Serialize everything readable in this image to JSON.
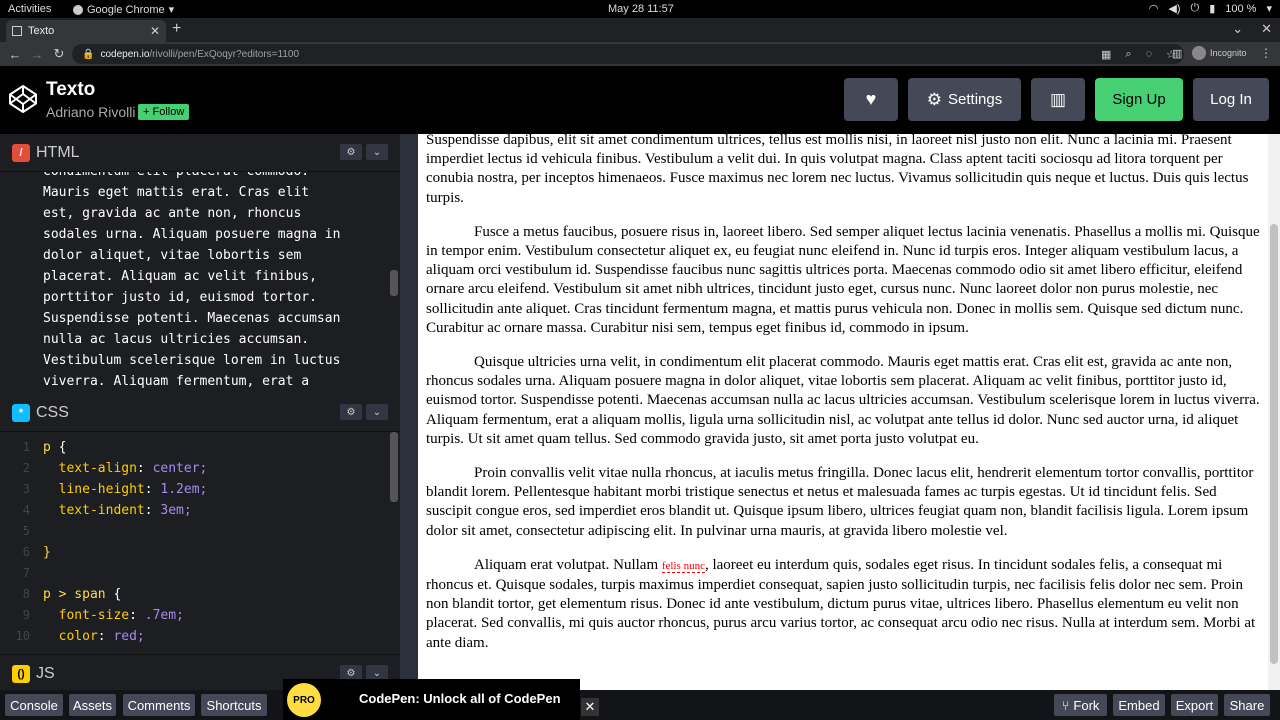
{
  "system_bar": {
    "activities": "Activities",
    "app_name": "Google Chrome",
    "clock": "May 28  11:57",
    "battery": "100 %"
  },
  "browser": {
    "tab_title": "Texto",
    "url_host": "codepen.io",
    "url_path": "/rivolli/pen/ExQoqyr?editors=1100",
    "profile": "Incognito"
  },
  "header": {
    "title": "Texto",
    "author": "Adriano Rivolli",
    "follow_label": "+ Follow",
    "settings_label": "Settings",
    "signup_label": "Sign Up",
    "login_label": "Log In"
  },
  "editors": {
    "html": {
      "title": "HTML",
      "lines": [
        "condimentum elit placerat commodo.",
        "Mauris eget mattis erat. Cras elit",
        "est, gravida ac ante non, rhoncus",
        "sodales urna. Aliquam posuere magna in",
        "dolor aliquet, vitae lobortis sem",
        "placerat. Aliquam ac velit finibus,",
        "porttitor justo id, euismod tortor.",
        "Suspendisse potenti. Maecenas accumsan",
        "nulla ac lacus ultricies accumsan.",
        "Vestibulum scelerisque lorem in luctus",
        "viverra. Aliquam fermentum, erat a"
      ]
    },
    "css": {
      "title": "CSS",
      "line_numbers": [
        "1",
        "2",
        "3",
        "4",
        "5",
        "6",
        "7",
        "8",
        "9",
        "10"
      ],
      "lines": [
        {
          "a": "p ",
          "b": "{",
          "c": ""
        },
        {
          "a": "  text-align",
          "b": ": ",
          "c": "center;"
        },
        {
          "a": "  line-height",
          "b": ": ",
          "c": "1.2em;"
        },
        {
          "a": "  text-indent",
          "b": ": ",
          "c": "3em;"
        },
        {
          "a": "",
          "b": "",
          "c": ""
        },
        {
          "a": "}",
          "b": "",
          "c": ""
        },
        {
          "a": "",
          "b": "",
          "c": ""
        },
        {
          "a": "p > span ",
          "b": "{",
          "c": ""
        },
        {
          "a": "  font-size",
          "b": ": ",
          "c": ".7em;"
        },
        {
          "a": "  color",
          "b": ": ",
          "c": "red;"
        }
      ]
    },
    "js": {
      "title": "JS"
    }
  },
  "preview": {
    "paragraphs": [
      "Suspendisse dapibus, elit sit amet condimentum ultrices, tellus est mollis nisi, in laoreet nisl justo non elit. Nunc a lacinia mi. Praesent imperdiet lectus id vehicula finibus. Vestibulum a velit dui. In quis volutpat magna. Class aptent taciti sociosqu ad litora torquent per conubia nostra, per inceptos himenaeos. Fusce maximus nec lorem nec luctus. Vivamus sollicitudin quis neque et luctus. Duis quis lectus turpis.",
      "Fusce a metus faucibus, posuere risus in, laoreet libero. Sed semper aliquet lectus lacinia venenatis. Phasellus a mollis mi. Quisque in tempor enim. Vestibulum consectetur aliquet ex, eu feugiat nunc eleifend in. Nunc id turpis eros. Integer aliquam vestibulum lacus, a aliquam orci vestibulum id. Suspendisse faucibus nunc sagittis ultrices porta. Maecenas commodo odio sit amet libero efficitur, eleifend ornare arcu eleifend. Vestibulum sit amet nibh ultrices, tincidunt justo eget, cursus nunc. Nunc laoreet dolor non purus molestie, nec sollicitudin ante aliquet. Cras tincidunt fermentum magna, et mattis purus vehicula non. Donec in mollis sem. Quisque sed dictum nunc. Curabitur ac ornare massa. Curabitur nisi sem, tempus eget finibus id, commodo in ipsum.",
      "Quisque ultricies urna velit, in condimentum elit placerat commodo. Mauris eget mattis erat. Cras elit est, gravida ac ante non, rhoncus sodales urna. Aliquam posuere magna in dolor aliquet, vitae lobortis sem placerat. Aliquam ac velit finibus, porttitor justo id, euismod tortor. Suspendisse potenti. Maecenas accumsan nulla ac lacus ultricies accumsan. Vestibulum scelerisque lorem in luctus viverra. Aliquam fermentum, erat a aliquam mollis, ligula urna sollicitudin nisl, ac volutpat ante tellus id dolor. Nunc sed auctor urna, id aliquet turpis. Ut sit amet quam tellus. Sed commodo gravida justo, sit amet porta justo volutpat eu.",
      "Proin convallis velit vitae nulla rhoncus, at iaculis metus fringilla. Donec lacus elit, hendrerit elementum tortor convallis, porttitor blandit lorem. Pellentesque habitant morbi tristique senectus et netus et malesuada fames ac turpis egestas. Ut id tincidunt felis. Sed suscipit congue eros, sed imperdiet eros blandit ut. Quisque ipsum libero, ultrices feugiat quam non, blandit facilisis ligula. Lorem ipsum dolor sit amet, consectetur adipiscing elit. In pulvinar urna mauris, at gravida libero molestie vel."
    ],
    "last_before": "Aliquam erat volutpat. Nullam ",
    "last_span": "felis nunc",
    "last_after": ", laoreet eu interdum quis, sodales eget risus. In tincidunt sodales felis, a consequat mi rhoncus et. Quisque sodales, turpis maximus imperdiet consequat, sapien justo sollicitudin turpis, nec facilisis felis dolor nec sem. Proin non blandit tortor, get elementum risus. Donec id ante vestibulum, dictum purus vitae, ultrices libero. Phasellus elementum eu velit non placerat. Sed convallis, mi quis auctor rhoncus, purus arcu varius tortor, ac consequat arcu odio nec risus. Nulla at interdum sem. Morbi at ante diam."
  },
  "footer": {
    "console": "Console",
    "assets": "Assets",
    "comments": "Comments",
    "shortcuts": "Shortcuts",
    "promo_badge": "PRO",
    "promo_text": "CodePen: Unlock all of CodePen",
    "fork": "Fork",
    "embed": "Embed",
    "export": "Export",
    "share": "Share"
  }
}
